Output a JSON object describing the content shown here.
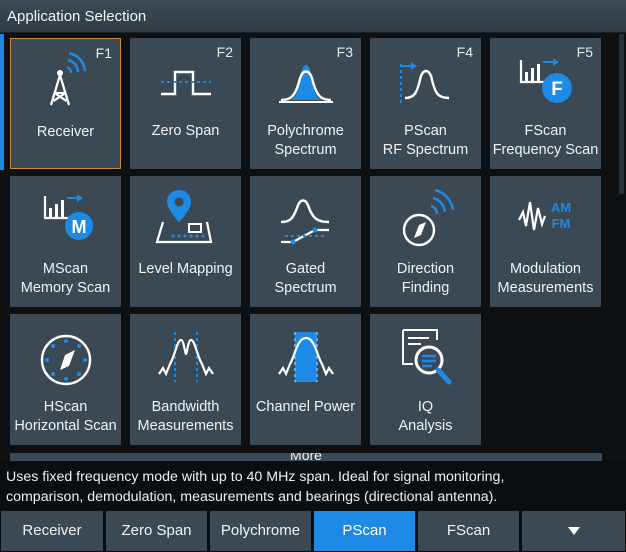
{
  "window": {
    "title": "Application Selection"
  },
  "tiles": [
    {
      "label_line1": "Receiver",
      "label_line2": "",
      "fkey": "F1",
      "icon": "receiver-antenna-icon"
    },
    {
      "label_line1": "Zero Span",
      "label_line2": "",
      "fkey": "F2",
      "icon": "zero-span-icon"
    },
    {
      "label_line1": "Polychrome",
      "label_line2": "Spectrum",
      "fkey": "F3",
      "icon": "polychrome-spectrum-icon"
    },
    {
      "label_line1": "PScan",
      "label_line2": "RF Spectrum",
      "fkey": "F4",
      "icon": "pscan-spectrum-icon"
    },
    {
      "label_line1": "FScan",
      "label_line2": "Frequency Scan",
      "fkey": "F5",
      "icon": "fscan-icon"
    },
    {
      "label_line1": "MScan",
      "label_line2": "Memory Scan",
      "fkey": "",
      "icon": "mscan-icon"
    },
    {
      "label_line1": "Level Mapping",
      "label_line2": "",
      "fkey": "",
      "icon": "level-mapping-icon"
    },
    {
      "label_line1": "Gated",
      "label_line2": "Spectrum",
      "fkey": "",
      "icon": "gated-spectrum-icon"
    },
    {
      "label_line1": "Direction",
      "label_line2": "Finding",
      "fkey": "",
      "icon": "direction-finding-icon"
    },
    {
      "label_line1": "Modulation",
      "label_line2": "Measurements",
      "fkey": "",
      "icon": "modulation-icon"
    },
    {
      "label_line1": "HScan",
      "label_line2": "Horizontal Scan",
      "fkey": "",
      "icon": "hscan-compass-icon"
    },
    {
      "label_line1": "Bandwidth",
      "label_line2": "Measurements",
      "fkey": "",
      "icon": "bandwidth-icon"
    },
    {
      "label_line1": "Channel Power",
      "label_line2": "",
      "fkey": "",
      "icon": "channel-power-icon"
    },
    {
      "label_line1": "IQ",
      "label_line2": "Analysis",
      "fkey": "",
      "icon": "iq-analysis-icon"
    }
  ],
  "icon_text": {
    "fscan": "F",
    "mscan": "M",
    "am": "AM",
    "fm": "FM"
  },
  "more": {
    "label": "More"
  },
  "description": {
    "line1": "Uses fixed frequency mode with up to 40 MHz span. Ideal for signal monitoring,",
    "line2": "comparison, demodulation, measurements and bearings (directional antenna)."
  },
  "tabs": [
    {
      "label": "Receiver",
      "active": false
    },
    {
      "label": "Zero Span",
      "active": false
    },
    {
      "label": "Polychrome",
      "active": false
    },
    {
      "label": "PScan",
      "active": true
    },
    {
      "label": "FScan",
      "active": false
    }
  ],
  "more_tab_icon": "triangle-down-icon",
  "colors": {
    "accent": "#1e8ae6",
    "tile": "#3a4954",
    "selection_border": "#d4862a",
    "icon_white": "#ffffff"
  }
}
